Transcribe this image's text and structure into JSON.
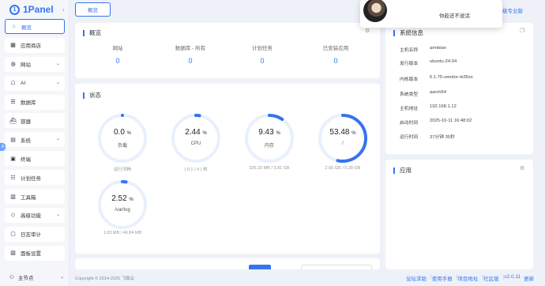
{
  "app": {
    "logo_mark": "1",
    "logo_text": "1Panel"
  },
  "sidebar": {
    "items": [
      {
        "icon": "home-icon",
        "glyph": "⌂",
        "label": "概览",
        "active": true,
        "chevron": false
      },
      {
        "icon": "app-store-icon",
        "glyph": "▦",
        "label": "应用商店",
        "chevron": false
      },
      {
        "icon": "globe-icon",
        "glyph": "◍",
        "label": "网站",
        "chevron": true
      },
      {
        "icon": "robot-icon",
        "glyph": "☖",
        "label": "AI",
        "chevron": true
      },
      {
        "icon": "database-icon",
        "glyph": "☰",
        "label": "数据库",
        "chevron": false
      },
      {
        "icon": "container-icon",
        "glyph": "⛴",
        "label": "容器",
        "chevron": false
      },
      {
        "icon": "system-icon",
        "glyph": "▤",
        "label": "系统",
        "chevron": true
      },
      {
        "icon": "terminal-icon",
        "glyph": "▣",
        "label": "终端",
        "chevron": false
      },
      {
        "icon": "cron-icon",
        "glyph": "☷",
        "label": "计划任务",
        "chevron": false
      },
      {
        "icon": "toolbox-icon",
        "glyph": "▥",
        "label": "工具箱",
        "chevron": false
      },
      {
        "icon": "diamond-icon",
        "glyph": "◇",
        "label": "高级功能",
        "chevron": true
      },
      {
        "icon": "log-icon",
        "glyph": "▢",
        "label": "日志审计",
        "chevron": false
      },
      {
        "icon": "settings-icon",
        "glyph": "▧",
        "label": "面板设置",
        "chevron": false
      }
    ],
    "node_label": "主节点"
  },
  "topbar": {
    "tab_label": "概览",
    "upgrade_label": "级专业版",
    "popup_text": "你趁还不说话"
  },
  "overview": {
    "title": "概览",
    "items": [
      {
        "label": "网站",
        "value": "0"
      },
      {
        "label": "数据库 - 所有",
        "value": "0"
      },
      {
        "label": "计划任务",
        "value": "0"
      },
      {
        "label": "已安装应用",
        "value": "0"
      }
    ]
  },
  "status": {
    "title": "状态",
    "gauges": [
      {
        "value": "0.0",
        "unit": "%",
        "label": "负载",
        "sub": "运行流畅",
        "percent": 0.0
      },
      {
        "value": "2.44",
        "unit": "%",
        "label": "CPU",
        "sub": "( 0.1 / 4 ) 核",
        "percent": 2.44
      },
      {
        "value": "9.43",
        "unit": "%",
        "label": "内存",
        "sub": "326.33 MB / 3.81 GB",
        "percent": 9.43
      },
      {
        "value": "53.48",
        "unit": "%",
        "label": "/",
        "sub": "2.66 GB / 5.28 GB",
        "percent": 53.48
      },
      {
        "value": "2.52",
        "unit": "%",
        "label": "/var/log",
        "sub": "1.03 MB / 46.84 MB",
        "percent": 2.52
      }
    ]
  },
  "sysinfo": {
    "title": "系统信息",
    "rows": [
      {
        "key": "主机名称",
        "value": "armbian"
      },
      {
        "key": "发行版本",
        "value": "ubuntu-24.04"
      },
      {
        "key": "内核版本",
        "value": "6.1.75-vendor-rk35xx"
      },
      {
        "key": "系统类型",
        "value": "aarch64"
      },
      {
        "key": "主机地址",
        "value": "192.168.1.12"
      },
      {
        "key": "启动时间",
        "value": "2025-10-11 16:48:02"
      },
      {
        "key": "运行时间",
        "value": "37分钟 35秒"
      }
    ]
  },
  "apps": {
    "title": "应用"
  },
  "footer": {
    "copyright": "Copyright © 2014-2025 飞致云",
    "links": [
      "论坛求助",
      "使用手册",
      "项目地址",
      "社区版"
    ],
    "version": "v2.0.11",
    "update": "更新"
  },
  "colors": {
    "accent": "#3574f0",
    "gauge_track": "#e8f0fd"
  }
}
